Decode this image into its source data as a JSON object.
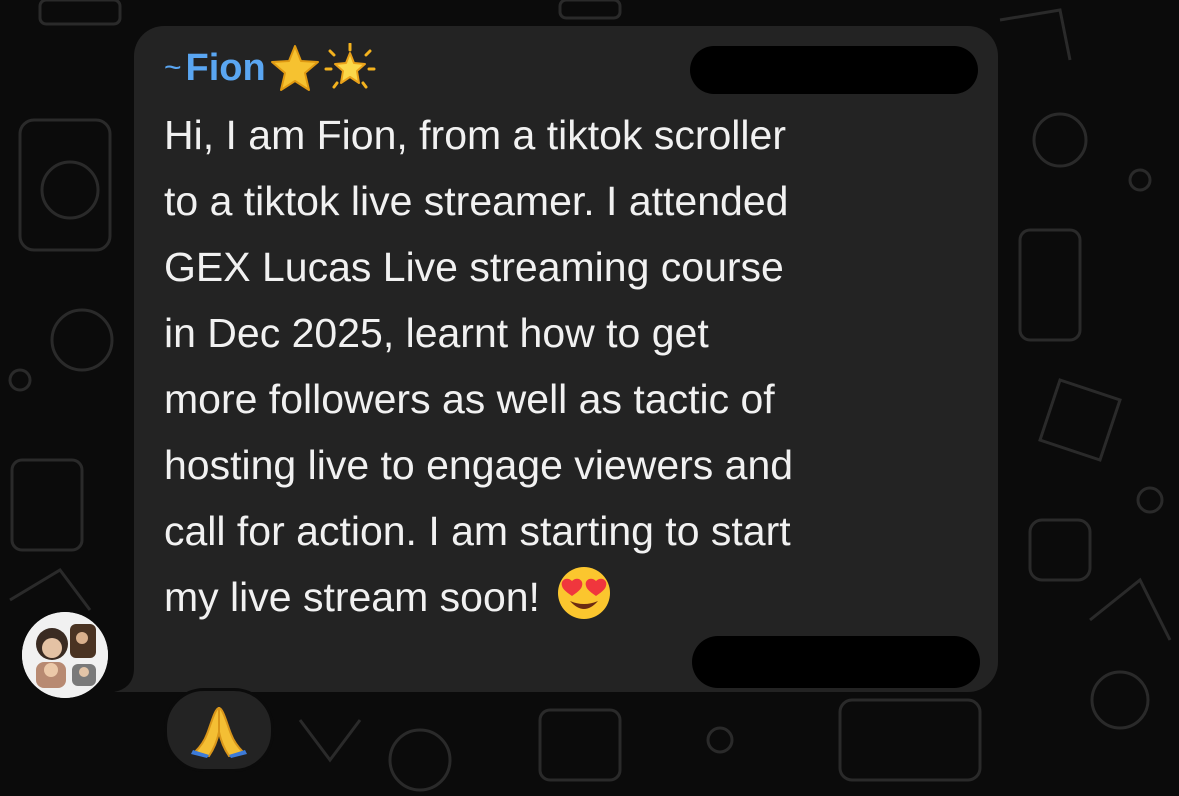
{
  "chat": {
    "message": {
      "sender": {
        "tilde": "~",
        "name": "Fion",
        "badges": [
          "star-icon",
          "glowing-star-icon"
        ],
        "name_color": "#5aa6f2"
      },
      "lines": [
        "Hi, I am Fion, from a tiktok scroller",
        "to a tiktok live streamer. I attended",
        "GEX Lucas Live streaming course",
        "in Dec 2025, learnt how to get",
        "more followers as well as tactic of",
        "hosting live to engage viewers and",
        "call for action. I am starting to start",
        "my live stream soon!"
      ],
      "trailing_emoji": "smiling-face-with-heart-eyes-icon",
      "bubble_color": "#232323",
      "text_color": "#f1f1f1"
    },
    "reaction": {
      "emoji": "folded-hands-icon"
    },
    "redacted": [
      "sender-phone-number",
      "message-timestamp"
    ],
    "background_color": "#0b0b0b"
  }
}
